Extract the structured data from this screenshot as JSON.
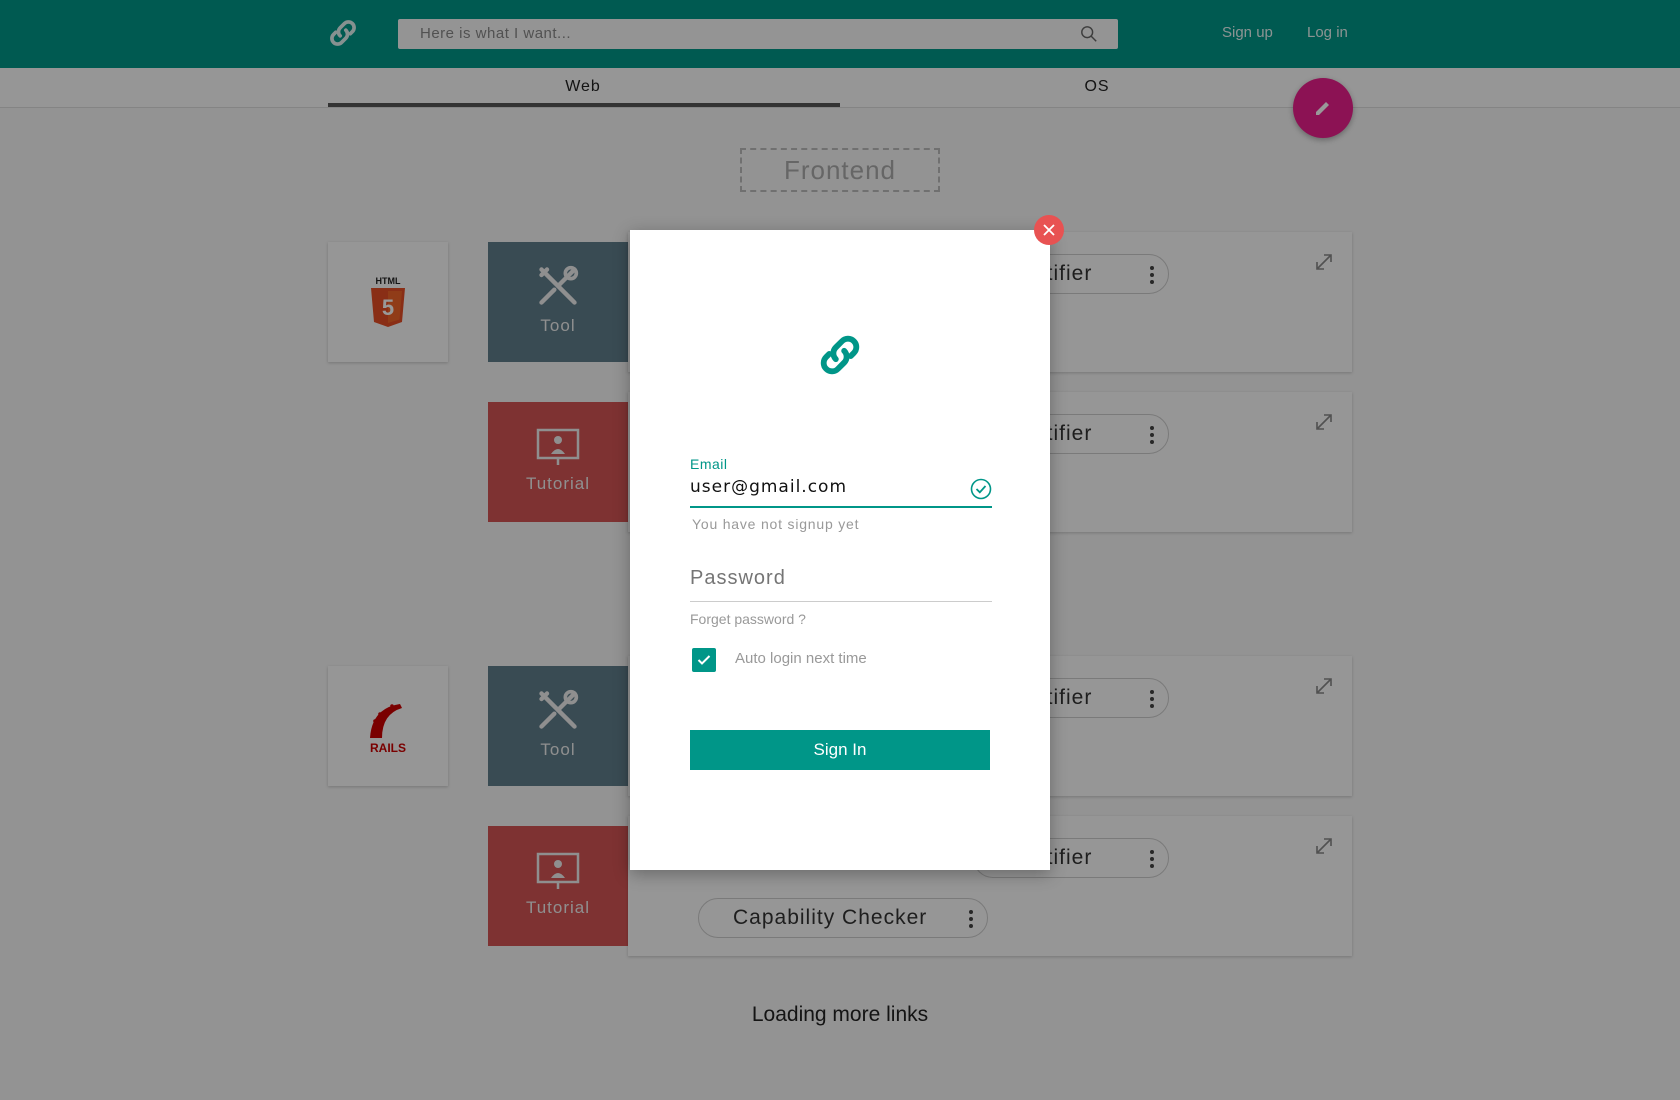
{
  "header": {
    "search_placeholder": "Here is what I want...",
    "signup_label": "Sign up",
    "login_label": "Log in"
  },
  "tabs": [
    {
      "label": "Web",
      "active": true
    },
    {
      "label": "OS",
      "active": false
    }
  ],
  "section_title": "Frontend",
  "cards": {
    "tool_label": "Tool",
    "tutorial_label": "Tutorial",
    "chip_partial": "utifier",
    "chip_capability": "Capability Checker",
    "tech_logos": [
      "html5-logo",
      "rails-logo"
    ],
    "html5_logo_text": "HTML",
    "rails_logo_text": "RAILS"
  },
  "loading_text": "Loading more links",
  "modal": {
    "email_label": "Email",
    "email_value": "user@gmail.com",
    "email_helper": "You have not signup yet",
    "password_placeholder": "Password",
    "forget_label": "Forget password ?",
    "auto_login_label": "Auto login next time",
    "auto_login_checked": true,
    "sign_in_label": "Sign In"
  },
  "colors": {
    "primary": "#009688",
    "fab": "#e91e8c",
    "tool": "#607d8b",
    "tutorial": "#d35454",
    "close": "#e85252"
  }
}
